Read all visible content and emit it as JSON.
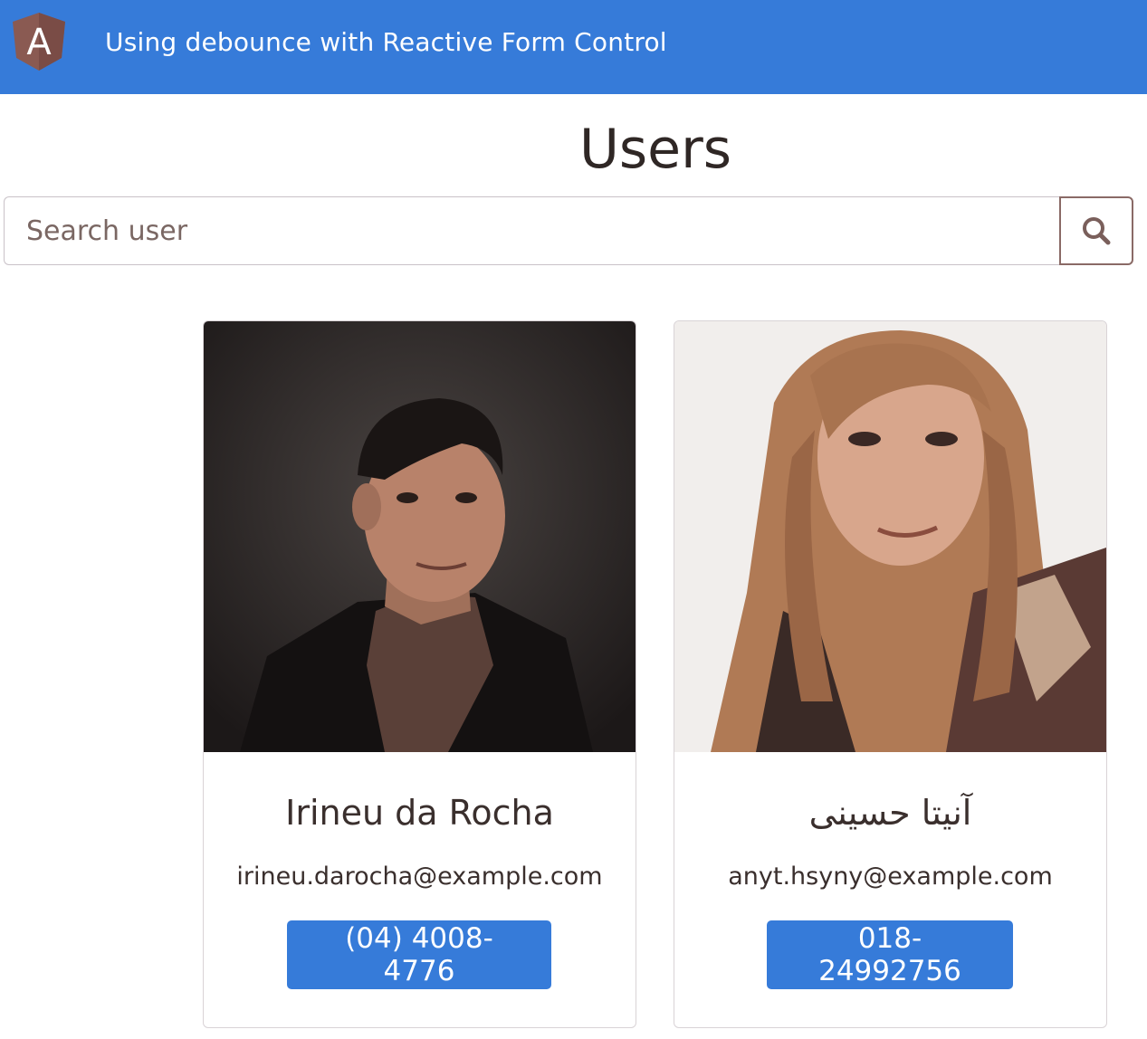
{
  "header": {
    "logo_letter": "A",
    "title": "Using debounce with Reactive Form Control",
    "logo_icon": "angular-logo-icon",
    "accent_color": "#367bd9"
  },
  "page": {
    "title": "Users"
  },
  "search": {
    "placeholder": "Search user",
    "value": "",
    "button_icon": "search-icon"
  },
  "users": [
    {
      "name": "Irineu da Rocha",
      "email": "irineu.darocha@example.com",
      "phone": "(04) 4008-4776",
      "photo_icon": "user-photo"
    },
    {
      "name": "آنیتا حسینی",
      "email": "anyt.hsyny@example.com",
      "phone": "018-24992756",
      "photo_icon": "user-photo"
    }
  ]
}
